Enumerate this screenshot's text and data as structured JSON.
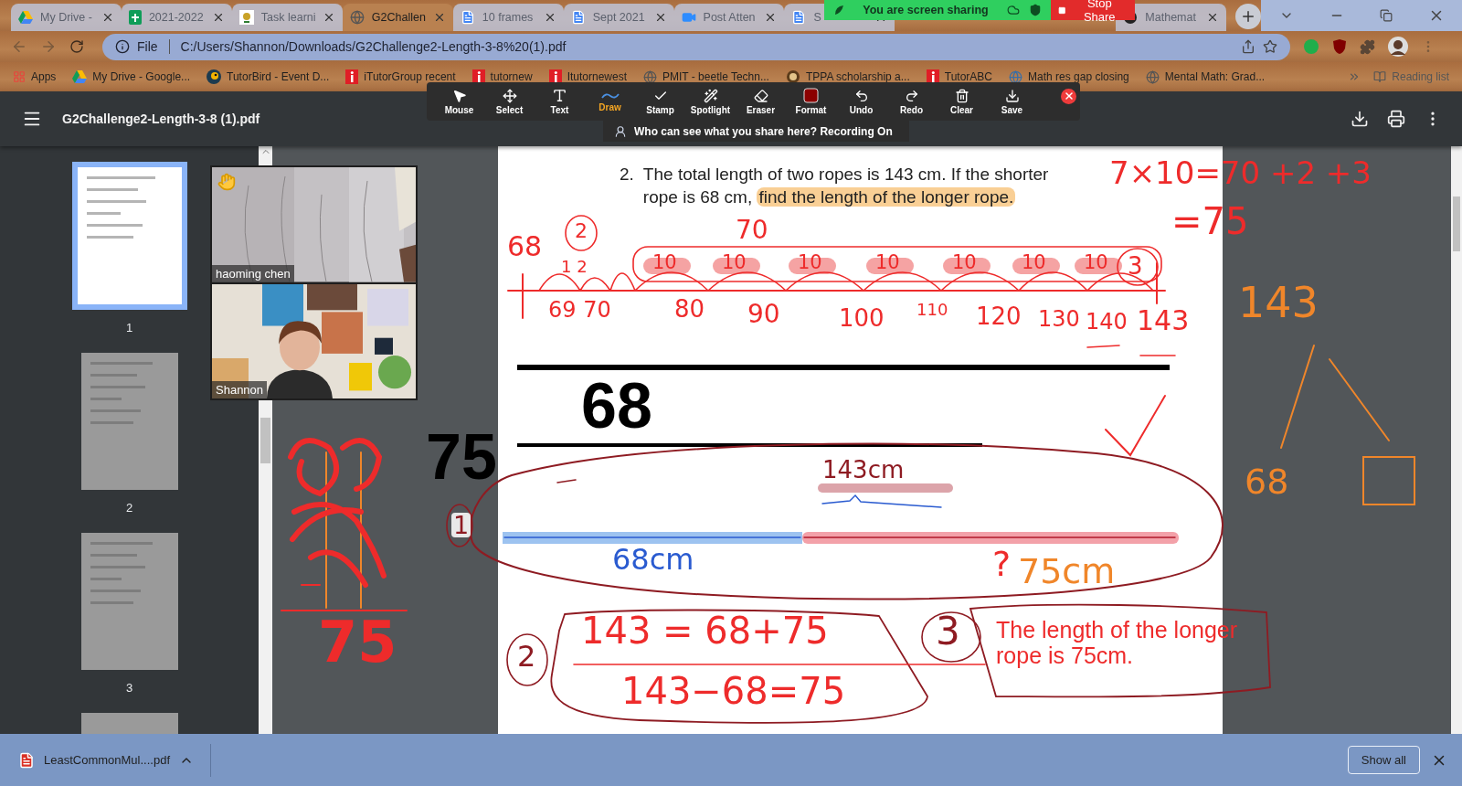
{
  "browser": {
    "tabs": [
      {
        "title": "My Drive -",
        "selected": false
      },
      {
        "title": "2021-2022",
        "selected": false
      },
      {
        "title": "Task learni",
        "selected": false
      },
      {
        "title": "G2Challen",
        "selected": true
      },
      {
        "title": "10 frames",
        "selected": false
      },
      {
        "title": "Sept 2021",
        "selected": false
      },
      {
        "title": "Post Atten",
        "selected": false
      },
      {
        "title": "S",
        "selected": false
      },
      {
        "title": "Mathemat",
        "selected": false
      }
    ],
    "address_scheme": "File",
    "address": "C:/Users/Shannon/Downloads/G2Challenge2-Length-3-8%20(1).pdf",
    "bookmarks": [
      "Apps",
      "My Drive - Google...",
      "TutorBird - Event D...",
      "iTutorGroup recent",
      "tutornew",
      "Itutornewest",
      "PMIT - beetle Techn...",
      "TPPA scholarship a...",
      "TutorABC",
      "Math res gap closing",
      "Mental Math: Grad..."
    ],
    "reading_list": "Reading list"
  },
  "share_bar": {
    "status": "You are screen sharing",
    "stop_label": "Stop Share"
  },
  "annotation_toolbar": {
    "tools": [
      {
        "label": "Mouse",
        "selected": false
      },
      {
        "label": "Select",
        "selected": false
      },
      {
        "label": "Text",
        "selected": false
      },
      {
        "label": "Draw",
        "selected": true
      },
      {
        "label": "Stamp",
        "selected": false
      },
      {
        "label": "Spotlight",
        "selected": false
      },
      {
        "label": "Eraser",
        "selected": false
      },
      {
        "label": "Format",
        "selected": false
      },
      {
        "label": "Undo",
        "selected": false
      },
      {
        "label": "Redo",
        "selected": false
      },
      {
        "label": "Clear",
        "selected": false
      },
      {
        "label": "Save",
        "selected": false
      }
    ],
    "notice": "Who can see what you share here? Recording On"
  },
  "pdf_viewer": {
    "title": "G2Challenge2-Length-3-8 (1).pdf",
    "thumbnails": [
      {
        "page": "1",
        "selected": true
      },
      {
        "page": "2",
        "selected": false
      },
      {
        "page": "3",
        "selected": false
      }
    ]
  },
  "participants": [
    {
      "name": "haoming chen",
      "hand_raised": true
    },
    {
      "name": "Shannon",
      "hand_raised": false
    }
  ],
  "page": {
    "number": "2.",
    "question": "The total length of two ropes is 143 cm. If the shorter rope is 68 cm,",
    "question_highlight": "find the length of the longer rope.",
    "text_boxes": [
      {
        "text": "68",
        "color": "#000000"
      },
      {
        "text": "75",
        "color": "#000000"
      },
      {
        "text": "The length of the longer rope is 75cm.",
        "color": "#ee2b2b"
      }
    ]
  },
  "ink": [
    {
      "text": "7×10=70 +2 +3",
      "color": "#ee2b2b"
    },
    {
      "text": "=75",
      "color": "#ee2b2b"
    },
    {
      "text": "68",
      "color": "#ee2b2b"
    },
    {
      "text": "2",
      "color": "#ee2b2b"
    },
    {
      "text": "1 2",
      "color": "#ee2b2b"
    },
    {
      "text": "70",
      "color": "#ee2b2b"
    },
    {
      "text": "10",
      "color": "#ee2b2b"
    },
    {
      "text": "10",
      "color": "#ee2b2b"
    },
    {
      "text": "10",
      "color": "#ee2b2b"
    },
    {
      "text": "10",
      "color": "#ee2b2b"
    },
    {
      "text": "10",
      "color": "#ee2b2b"
    },
    {
      "text": "10",
      "color": "#ee2b2b"
    },
    {
      "text": "10",
      "color": "#ee2b2b"
    },
    {
      "text": "3",
      "color": "#ee2b2b"
    },
    {
      "text": "69 70",
      "color": "#ee2b2b"
    },
    {
      "text": "80",
      "color": "#ee2b2b"
    },
    {
      "text": "90",
      "color": "#ee2b2b"
    },
    {
      "text": "100",
      "color": "#ee2b2b"
    },
    {
      "text": "110",
      "color": "#ee2b2b"
    },
    {
      "text": "120",
      "color": "#ee2b2b"
    },
    {
      "text": "130",
      "color": "#ee2b2b"
    },
    {
      "text": "140",
      "color": "#ee2b2b"
    },
    {
      "text": "143",
      "color": "#ee2b2b"
    },
    {
      "text": "143cm",
      "color": "#8e1b22"
    },
    {
      "text": "1",
      "color": "#8e1b22"
    },
    {
      "text": "68cm",
      "color": "#2a5bd0"
    },
    {
      "text": "?",
      "color": "#ee2b2b"
    },
    {
      "text": "75cm",
      "color": "#f0862a"
    },
    {
      "text": "2",
      "color": "#8e1b22"
    },
    {
      "text": "143 = 68+75",
      "color": "#ee2b2b"
    },
    {
      "text": "143−68=75",
      "color": "#ee2b2b"
    },
    {
      "text": "3",
      "color": "#8e1b22"
    },
    {
      "text": "143",
      "color": "#f0862a"
    },
    {
      "text": "68",
      "color": "#f0862a"
    },
    {
      "text": "75",
      "color": "#ee2b2b"
    }
  ],
  "download_bar": {
    "file": "LeastCommonMul....pdf",
    "show_all": "Show all"
  }
}
